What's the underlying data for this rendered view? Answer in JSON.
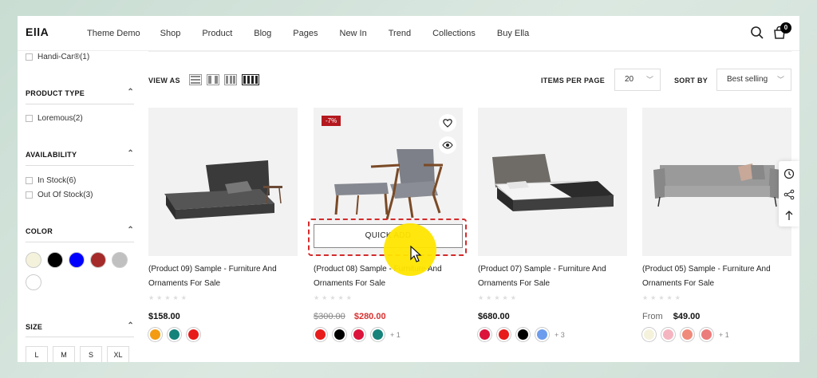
{
  "header": {
    "logo": "EllA",
    "nav": [
      "Theme Demo",
      "Shop",
      "Product",
      "Blog",
      "Pages",
      "New In",
      "Trend",
      "Collections",
      "Buy Ella"
    ],
    "cart_count": "0"
  },
  "sidebar": {
    "brand_item": "Handi-Car®(1)",
    "product_type": {
      "title": "PRODUCT TYPE",
      "items": [
        "Loremous(2)"
      ]
    },
    "availability": {
      "title": "AVAILABILITY",
      "items": [
        "In Stock(6)",
        "Out Of Stock(3)"
      ]
    },
    "color": {
      "title": "COLOR",
      "swatches": [
        "#f5f2dc",
        "#000000",
        "#0000ff",
        "#a52a2a",
        "#c0c0c0",
        "#ffffff"
      ]
    },
    "size": {
      "title": "SIZE",
      "options": [
        "L",
        "M",
        "S",
        "XL"
      ]
    }
  },
  "toolbar": {
    "view_as": "VIEW AS",
    "items_per_page_label": "ITEMS PER PAGE",
    "items_per_page_value": "20",
    "sort_by_label": "SORT BY",
    "sort_by_value": "Best selling"
  },
  "products": [
    {
      "title": "(Product 09) Sample - Furniture And Ornaments For Sale",
      "price": "$158.00",
      "swatches": [
        "#f39c12",
        "#16837a",
        "#e81b1b"
      ]
    },
    {
      "title": "(Product 08) Sample - Furniture And Ornaments For Sale",
      "badge": "-7%",
      "quick_add": "QUICK ADD",
      "old_price": "$300.00",
      "price": "$280.00",
      "swatches": [
        "#e81b1b",
        "#000000",
        "#dc143c",
        "#16837a"
      ],
      "more": "+ 1"
    },
    {
      "title": "(Product 07) Sample - Furniture And Ornaments For Sale",
      "price": "$680.00",
      "swatches": [
        "#dc143c",
        "#e81b1b",
        "#000000",
        "#6c9ced"
      ],
      "more": "+ 3"
    },
    {
      "title": "(Product 05) Sample - Furniture And Ornaments For Sale",
      "from": "From",
      "price": "$49.00",
      "swatches": [
        "#f5f2dc",
        "#f5b5c0",
        "#f08a7a",
        "#ec7b7b"
      ],
      "more": "+ 1"
    }
  ],
  "stars": "★★★★★",
  "colors": {
    "sale": "#d9302f",
    "badge": "#b4191f",
    "highlight": "#d32b2b",
    "cursor": "#ffe600"
  }
}
